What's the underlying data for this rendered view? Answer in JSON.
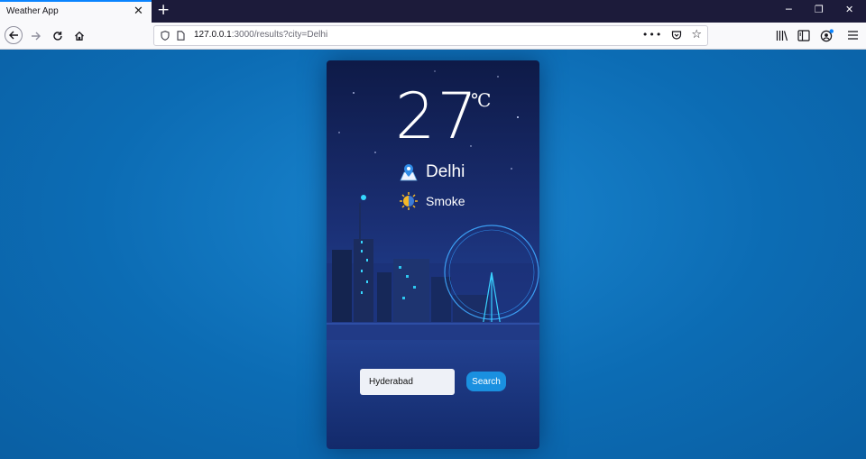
{
  "browser": {
    "tab_title": "Weather App",
    "url_host": "127.0.0.1",
    "url_rest": ":3000/results?city=Delhi"
  },
  "weather": {
    "temperature": "27",
    "unit": "℃",
    "city": "Delhi",
    "condition": "Smoke"
  },
  "search": {
    "input_value": "Hyderabad",
    "button_label": "Search"
  },
  "icons": {
    "location": "map-location-icon",
    "condition": "sun-smoke-icon"
  }
}
